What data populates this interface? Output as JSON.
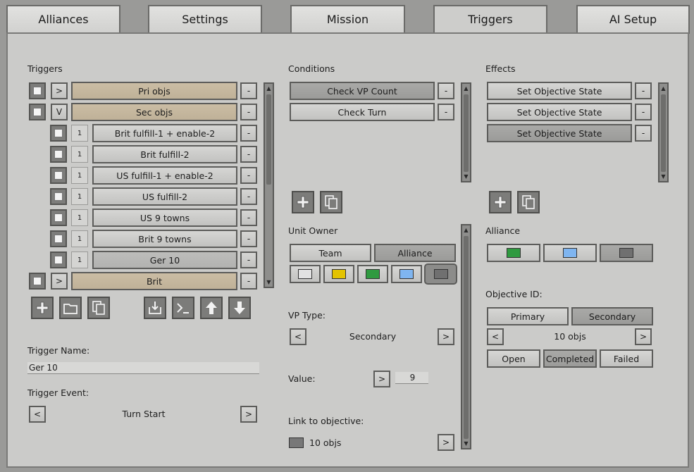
{
  "tabs": [
    {
      "label": "Alliances"
    },
    {
      "label": "Settings"
    },
    {
      "label": "Mission"
    },
    {
      "label": "Triggers"
    },
    {
      "label": "AI Setup"
    }
  ],
  "triggers": {
    "title": "Triggers",
    "items": [
      {
        "name": "Pri objs",
        "toggle": ">",
        "num": ""
      },
      {
        "name": "Sec objs",
        "toggle": "V",
        "num": ""
      },
      {
        "name": "Brit fulfill-1 + enable-2",
        "num": "1"
      },
      {
        "name": "Brit fulfill-2",
        "num": "1"
      },
      {
        "name": "US fulfill-1 + enable-2",
        "num": "1"
      },
      {
        "name": "US fulfill-2",
        "num": "1"
      },
      {
        "name": "US 9 towns",
        "num": "1"
      },
      {
        "name": "Brit 9 towns",
        "num": "1"
      },
      {
        "name": "Ger 10",
        "num": "1"
      },
      {
        "name": "Brit",
        "toggle": ">",
        "num": ""
      }
    ],
    "minus": "-",
    "trigger_name_label": "Trigger Name:",
    "trigger_name_value": "Ger 10",
    "trigger_event_label": "Trigger Event:",
    "trigger_event_value": "Turn Start",
    "prev": "<",
    "next": ">"
  },
  "conditions": {
    "title": "Conditions",
    "items": [
      "Check VP Count",
      "Check Turn"
    ],
    "unit_owner_label": "Unit Owner",
    "owner_tabs": [
      "Team",
      "Alliance"
    ],
    "owner_colors": [
      "#e2e2e2",
      "#e3c300",
      "#2f9a40",
      "#7fb5f0",
      "#707070"
    ],
    "vp_type_label": "VP Type:",
    "vp_type_value": "Secondary",
    "value_label": "Value:",
    "value": "9",
    "link_label": "Link to objective:",
    "link_value": "10 objs",
    "link_color": "#787878"
  },
  "effects": {
    "title": "Effects",
    "items": [
      "Set Objective State",
      "Set Objective State",
      "Set Objective State"
    ],
    "alliance_label": "Alliance",
    "alliance_colors": [
      "#2f9a40",
      "#7fb5f0",
      "#707070"
    ],
    "objective_id_label": "Objective ID:",
    "objective_kind": [
      "Primary",
      "Secondary"
    ],
    "objective_value": "10 objs",
    "states": [
      "Open",
      "Completed",
      "Failed"
    ]
  },
  "arrows": {
    "up": "▲",
    "down": "▼"
  }
}
